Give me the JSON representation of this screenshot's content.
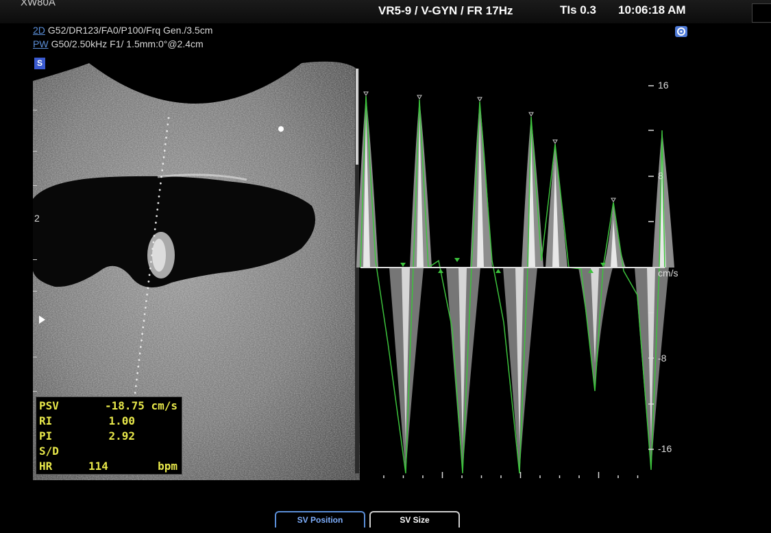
{
  "header": {
    "model": "XW80A",
    "probe": "VR5-9 / V-GYN / FR 17Hz",
    "tis": "TIs 0.3",
    "time": "10:06:18 AM"
  },
  "params": {
    "mode_2d": "2D",
    "params_2d": "G52/DR123/FA0/P100/Frq Gen./3.5cm",
    "mode_pw": "PW",
    "params_pw": "G50/2.50kHz F1/ 1.5mm:0°@2.4cm",
    "s_badge": "S"
  },
  "depth_scale": {
    "marker": "2"
  },
  "velocity_scale": {
    "top": "16",
    "upper": "8",
    "unit": "cm/s",
    "lower": "-8",
    "bottom": "-16"
  },
  "measurements": {
    "psv_label": "PSV",
    "psv_value": "-18.75 cm/s",
    "ri_label": "RI",
    "ri_value": "1.00",
    "pi_label": "PI",
    "pi_value": "2.92",
    "sd_label": "S/D",
    "sd_value": "",
    "hr_label": "HR",
    "hr_value": "114",
    "hr_unit": "bpm"
  },
  "softkeys": {
    "sv_position": "SV Position",
    "sv_size": "SV Size"
  },
  "colors": {
    "trace_green": "#3cc23c",
    "measure_yellow": "#e8e84a",
    "accent_blue": "#5b8fd9"
  }
}
